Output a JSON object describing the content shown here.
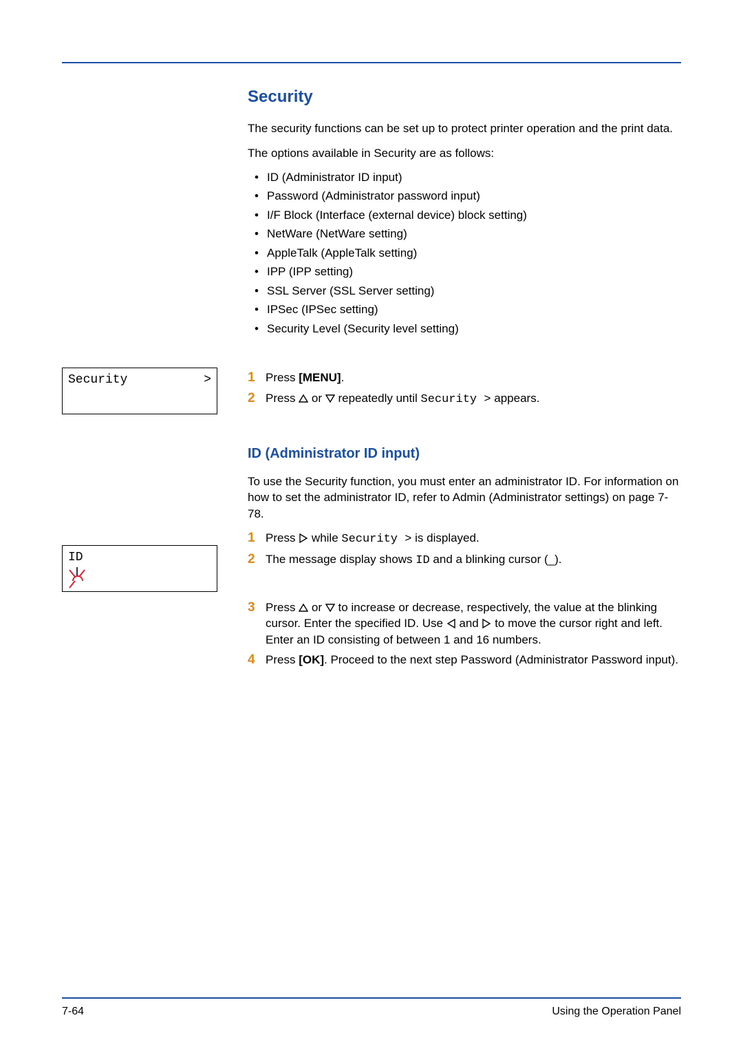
{
  "headings": {
    "security": "Security",
    "id_input": "ID (Administrator ID input)"
  },
  "intro": {
    "p1": "The security functions can be set up to protect printer operation and the print data.",
    "p2": "The options available in Security are as follows:"
  },
  "options": [
    "ID (Administrator ID input)",
    "Password (Administrator password input)",
    "I/F Block (Interface (external device) block setting)",
    "NetWare (NetWare setting)",
    "AppleTalk (AppleTalk setting)",
    "IPP (IPP setting)",
    "SSL Server (SSL Server setting)",
    "IPSec (IPSec setting)",
    "Security Level (Security level setting)"
  ],
  "sec_steps": {
    "s1_pre": "Press ",
    "s1_bold": "[MENU]",
    "s1_post": ".",
    "s2_a": "Press ",
    "s2_b": " or ",
    "s2_c": " repeatedly until ",
    "s2_mono": "Security >",
    "s2_d": " appears."
  },
  "lcd": {
    "security": "Security",
    "security_gt": ">",
    "id": "ID"
  },
  "id_section": {
    "intro": "To use the Security function, you must enter an administrator ID. For information on how to set the administrator ID, refer to Admin (Administrator settings) on page 7-78.",
    "s1_a": "Press ",
    "s1_b": " while ",
    "s1_mono": "Security >",
    "s1_c": " is displayed.",
    "s2_a": "The message display shows ",
    "s2_mono": "ID",
    "s2_b": " and a blinking cursor (",
    "s2_cursor": "_",
    "s2_c": ").",
    "s3_a": "Press ",
    "s3_b": " or ",
    "s3_c": " to increase or decrease, respectively, the value at the blinking cursor. Enter the specified ID. Use ",
    "s3_d": " and ",
    "s3_e": " to move the cursor right and left. Enter an ID consisting of between 1 and 16 numbers.",
    "s4_a": "Press ",
    "s4_bold": "[OK]",
    "s4_b": ". Proceed to the next step Password (Administrator Password input)."
  },
  "step_nums": {
    "n1": "1",
    "n2": "2",
    "n3": "3",
    "n4": "4"
  },
  "footer": {
    "left": "7-64",
    "right": "Using the Operation Panel"
  }
}
